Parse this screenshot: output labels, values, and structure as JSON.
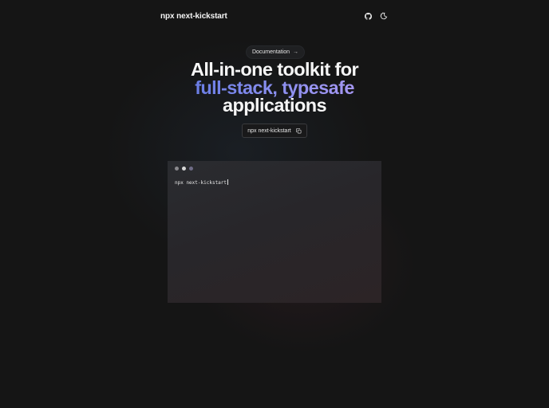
{
  "header": {
    "brand": "npx next-kickstart",
    "icons": [
      "github-icon",
      "theme-toggle-icon"
    ]
  },
  "hero": {
    "pill_label": "Documentation",
    "pill_arrow": "→",
    "title_line1": "All-in-one toolkit for",
    "title_line2": "full-stack, typesafe",
    "title_line3": "applications"
  },
  "command": {
    "label": "npx next-kickstart",
    "icon": "copy-icon"
  },
  "terminal": {
    "command_text": "npx next-kickstart",
    "dot_colors": [
      "#8a8a8e",
      "#d6d6d6",
      "#6f6c86"
    ]
  },
  "colors": {
    "background": "#151515",
    "accent_start": "#6a7de4",
    "accent_end": "#a597f2"
  }
}
